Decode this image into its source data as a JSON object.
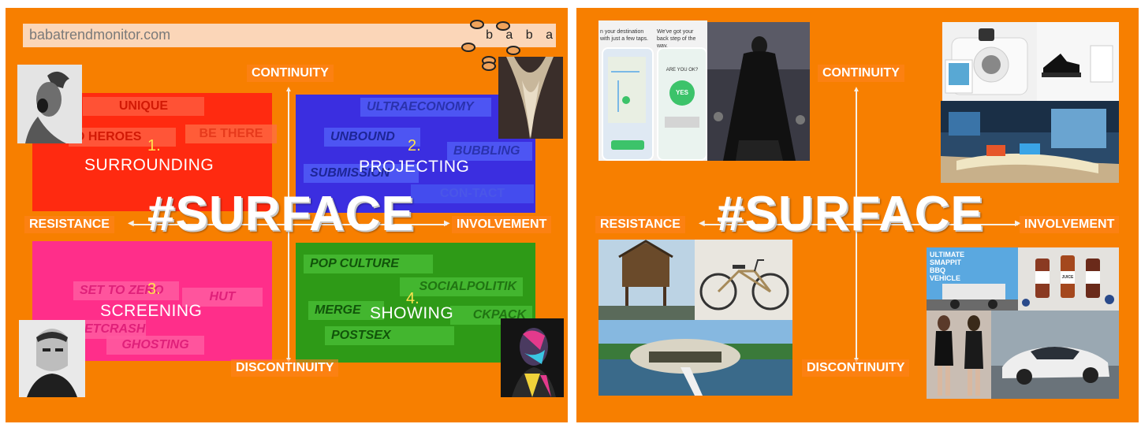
{
  "colors": {
    "background": "#f77f00",
    "q1": "#ff2a10",
    "q2": "#3b2ee0",
    "q3": "#ff2e8a",
    "q4": "#2e9a17",
    "number": "#ffe34d"
  },
  "left": {
    "url": "babatrendmonitor.com",
    "brand": "b a b a",
    "title": "#SURFACE",
    "axes": {
      "top": "CONTINUITY",
      "bottom": "DISCONTINUITY",
      "left": "RESISTANCE",
      "right": "INVOLVEMENT"
    },
    "quadrants": [
      {
        "number": "1.",
        "title": "SURROUNDING",
        "tags": [
          "UNIQUE",
          "O HEROES",
          "BE THERE"
        ]
      },
      {
        "number": "2.",
        "title": "PROJECTING",
        "tags": [
          "ULTRAECONOMY",
          "UNBOUND",
          "BUBBLING",
          "SUBMISSION",
          "CON-TACT"
        ]
      },
      {
        "number": "3.",
        "title": "SCREENING",
        "tags": [
          "SET TO ZERO",
          "HUT",
          "ETCRASH",
          "GHOSTING"
        ]
      },
      {
        "number": "4.",
        "title": "SHOWING",
        "tags": [
          "POP CULTURE",
          "SOCIALPOLITIK",
          "MERGE",
          "CKPACK",
          "POSTSEX"
        ]
      }
    ]
  },
  "right": {
    "title": "#SURFACE",
    "axes": {
      "top": "CONTINUITY",
      "bottom": "DISCONTINUITY",
      "left": "RESISTANCE",
      "right": "INVOLVEMENT"
    },
    "app_screens": {
      "left_text": "n your destination with just a few taps.",
      "right_text": "We've got your back step of the way.",
      "question": "ARE YOU OK?",
      "answer": "YES"
    },
    "bbq_sign": "ULTIMATE SMAPPIT BBQ VEHICLE",
    "juice_label": "JUICE"
  }
}
